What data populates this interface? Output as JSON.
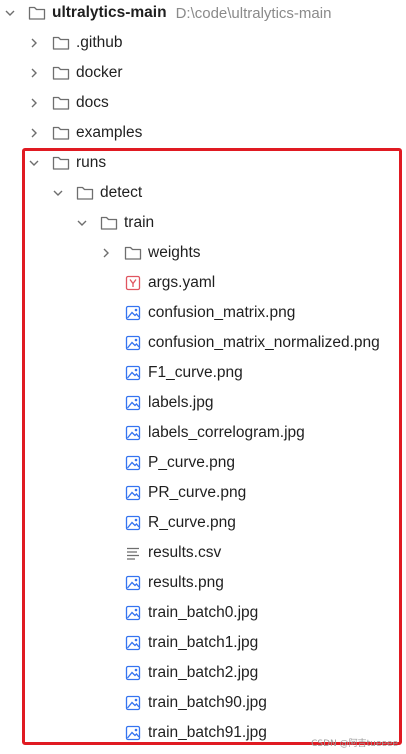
{
  "project": {
    "name": "ultralytics-main",
    "path": "D:\\code\\ultralytics-main"
  },
  "tree": {
    "github": ".github",
    "docker": "docker",
    "docs": "docs",
    "examples": "examples",
    "runs": "runs",
    "detect": "detect",
    "train": "train",
    "weights": "weights",
    "files": [
      {
        "name": "args.yaml",
        "icon": "yaml-file-icon"
      },
      {
        "name": "confusion_matrix.png",
        "icon": "image-file-icon"
      },
      {
        "name": "confusion_matrix_normalized.png",
        "icon": "image-file-icon"
      },
      {
        "name": "F1_curve.png",
        "icon": "image-file-icon"
      },
      {
        "name": "labels.jpg",
        "icon": "image-file-icon"
      },
      {
        "name": "labels_correlogram.jpg",
        "icon": "image-file-icon"
      },
      {
        "name": "P_curve.png",
        "icon": "image-file-icon"
      },
      {
        "name": "PR_curve.png",
        "icon": "image-file-icon"
      },
      {
        "name": "R_curve.png",
        "icon": "image-file-icon"
      },
      {
        "name": "results.csv",
        "icon": "text-file-icon"
      },
      {
        "name": "results.png",
        "icon": "image-file-icon"
      },
      {
        "name": "train_batch0.jpg",
        "icon": "image-file-icon"
      },
      {
        "name": "train_batch1.jpg",
        "icon": "image-file-icon"
      },
      {
        "name": "train_batch2.jpg",
        "icon": "image-file-icon"
      },
      {
        "name": "train_batch90.jpg",
        "icon": "image-file-icon"
      },
      {
        "name": "train_batch91.jpg",
        "icon": "image-file-icon"
      }
    ]
  },
  "watermark": "CSDN @阿吉tueeee",
  "colors": {
    "highlight_border": "#e01a22",
    "folder_stroke": "#6e6e6e",
    "image_icon": "#3574f0",
    "yaml_icon": "#e05560",
    "path_text": "#8a8a8a"
  }
}
